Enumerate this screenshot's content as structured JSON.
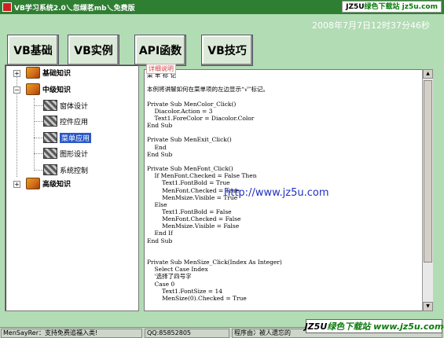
{
  "window": {
    "title": "VB学习系统2.0乀忽缬茗mb乀免费版"
  },
  "watermarks": {
    "top_brand": "JZ5U",
    "top_text": "绿色下载站 jz5u.com",
    "mid": "http://www.jz5u.com",
    "bottom_brand": "JZ5U",
    "bottom_text": "绿色下载站 www.jz5u.com"
  },
  "datetime": "2008年7月7日12时37分46秒",
  "top_buttons": [
    "VB基础",
    "VB实例",
    "API函数",
    "VB技巧"
  ],
  "tree": {
    "roots": [
      {
        "label": "基础知识",
        "expander": "+"
      },
      {
        "label": "中级知识",
        "expander": "−"
      },
      {
        "label": "高级知识",
        "expander": "+"
      }
    ],
    "children": [
      "窗体设计",
      "控件应用",
      "菜单应用",
      "图形设计",
      "系统控制"
    ],
    "selected": "菜单应用"
  },
  "detail": {
    "label": "详细说明",
    "code": "菜 单 标 记\n\n本例将讲解如何在菜单项的左边显示“√”标记。\n\nPrivate Sub MenColor_Click()\n    Diacolor.Action = 3\n    Text1.ForeColor = Diacolor.Color\nEnd Sub\n\nPrivate Sub MenExit_Click()\n    End\nEnd Sub\n\nPrivate Sub MenFont_Click()\n    If MenFont.Checked = False Then\n        Text1.FontBold = True\n        MenFont.Checked = True\n        MenMsize.Visible = True\n    Else\n        Text1.FontBold = False\n        MenFont.Checked = False\n        MenMsize.Visible = False\n    End If\nEnd Sub\n\n\nPrivate Sub MenSize_Click(Index As Integer)\n    Select Case Index\n    '选择了四号字\n    Case 0\n        Text1.FontSize = 14\n        MenSize(0).Checked = True"
  },
  "statusbar": {
    "left": "MenSayRer：支持免费追福入类!",
    "middle": "QQ:85852805",
    "right": "程序由冫被人遗忘的"
  }
}
